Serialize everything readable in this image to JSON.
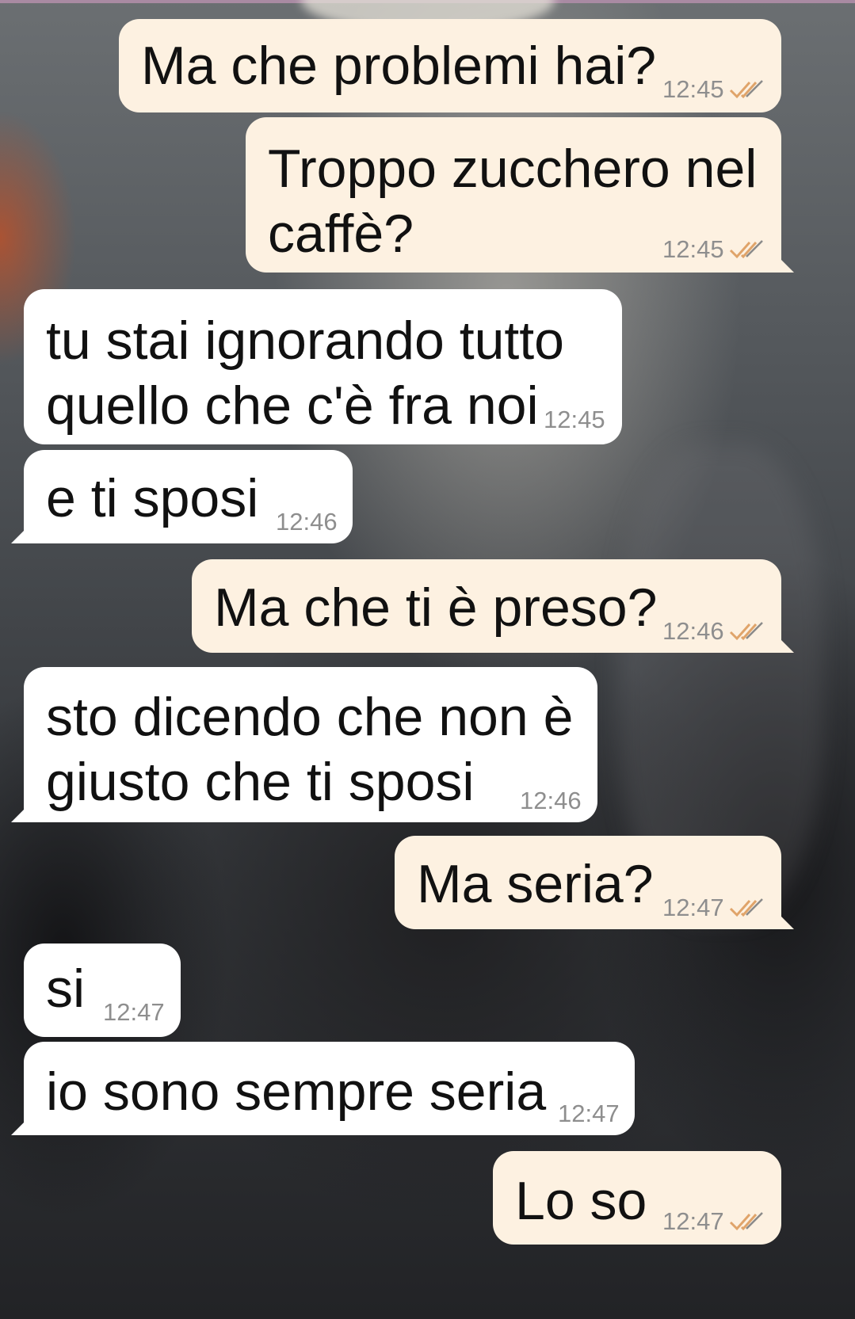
{
  "colors": {
    "outgoing_bubble": "#fdf1e1",
    "incoming_bubble": "#ffffff",
    "timestamp": "#8e8e8e",
    "read_ticks": "#e0a46a"
  },
  "messages": [
    {
      "direction": "out",
      "text": "Ma che problemi hai?",
      "time": "12:45",
      "status_icon": "double-check-icon"
    },
    {
      "direction": "out",
      "text": "Troppo zucchero nel\ncaffè?",
      "time": "12:45",
      "status_icon": "double-check-icon"
    },
    {
      "direction": "in",
      "text": "tu stai ignorando tutto\nquello che c'è fra noi",
      "time": "12:45"
    },
    {
      "direction": "in",
      "text": "e ti sposi",
      "time": "12:46"
    },
    {
      "direction": "out",
      "text": "Ma che ti è preso?",
      "time": "12:46",
      "status_icon": "double-check-icon"
    },
    {
      "direction": "in",
      "text": "sto dicendo che non è\ngiusto che ti sposi",
      "time": "12:46"
    },
    {
      "direction": "out",
      "text": "Ma seria?",
      "time": "12:47",
      "status_icon": "double-check-icon"
    },
    {
      "direction": "in",
      "text": "si",
      "time": "12:47"
    },
    {
      "direction": "in",
      "text": "io sono sempre seria",
      "time": "12:47"
    },
    {
      "direction": "out",
      "text": "Lo so",
      "time": "12:47",
      "status_icon": "double-check-icon"
    }
  ]
}
